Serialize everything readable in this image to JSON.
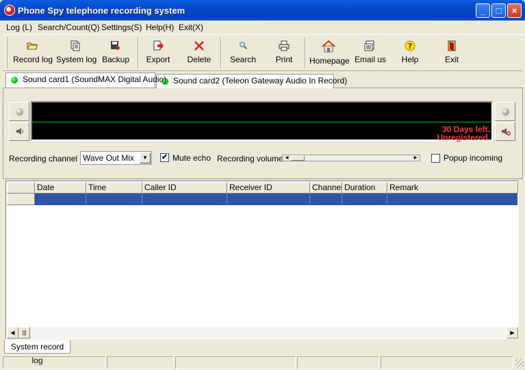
{
  "window": {
    "title": "Phone Spy telephone recording system",
    "buttons": {
      "minimize": "_",
      "maximize": "□",
      "close": "×"
    }
  },
  "menu": [
    "Log (L)",
    "Search/Count(Q)",
    "Settings(S)",
    "Help(H)",
    "Exit(X)"
  ],
  "toolbar": {
    "record_log": "Record log",
    "system_log": "System log",
    "backup": "Backup",
    "export": "Export",
    "delete": "Delete",
    "search": "Search",
    "print": "Print",
    "homepage": "Homepage",
    "email": "Email us",
    "help": "Help",
    "exit": "Exit"
  },
  "tabs": [
    {
      "label": "Sound card1 (SoundMAX Digital Audio)",
      "active": true
    },
    {
      "label": "Sound card2 (Teleon Gateway Audio In Record)",
      "active": false
    }
  ],
  "monitor": {
    "trial_line1": "30 Days left.",
    "trial_line2": "Unregistered."
  },
  "controls": {
    "channel_label": "Recording channel",
    "channel_value": "Wave Out Mix",
    "mute_echo_label": "Mute echo",
    "mute_echo_checked": "✔",
    "volume_label": "Recording volume",
    "popup_label": "Popup incoming"
  },
  "table": {
    "columns": [
      "Date",
      "Time",
      "Caller ID",
      "Receiver ID",
      "Channel",
      "Duration",
      "Remark"
    ]
  },
  "bottom_tab": "System record log",
  "colors": {
    "title_blue": "#0549c8",
    "selection": "#2c55a8",
    "trial_red": "#ff3030",
    "led_green": "#00c800"
  }
}
